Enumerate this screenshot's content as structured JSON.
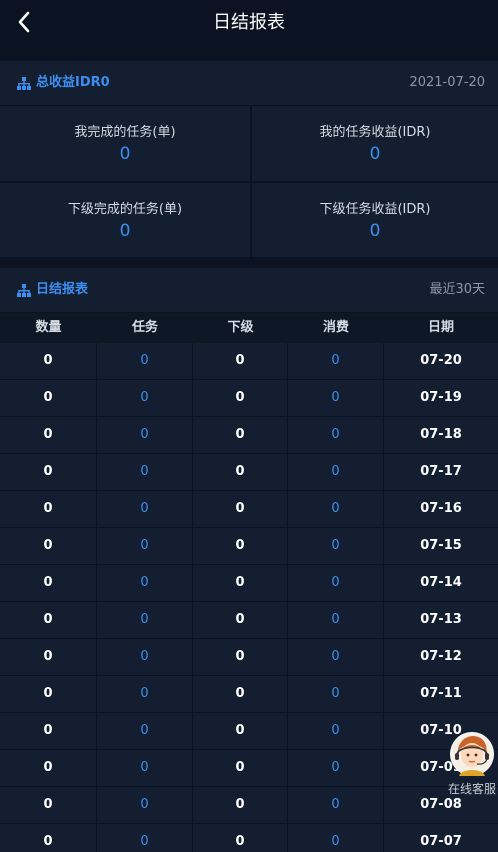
{
  "header": {
    "title": "日结报表"
  },
  "summary": {
    "title": "总收益IDR0",
    "date": "2021-07-20",
    "stats": [
      {
        "label": "我完成的任务(单)",
        "value": "0"
      },
      {
        "label": "我的任务收益(IDR)",
        "value": "0"
      },
      {
        "label": "下级完成的任务(单)",
        "value": "0"
      },
      {
        "label": "下级任务收益(IDR)",
        "value": "0"
      }
    ]
  },
  "daily": {
    "title": "日结报表",
    "range": "最近30天",
    "columns": [
      "数量",
      "任务",
      "下级",
      "消费",
      "日期"
    ],
    "rows": [
      {
        "qty": "0",
        "task": "0",
        "sub": "0",
        "spend": "0",
        "date": "07-20"
      },
      {
        "qty": "0",
        "task": "0",
        "sub": "0",
        "spend": "0",
        "date": "07-19"
      },
      {
        "qty": "0",
        "task": "0",
        "sub": "0",
        "spend": "0",
        "date": "07-18"
      },
      {
        "qty": "0",
        "task": "0",
        "sub": "0",
        "spend": "0",
        "date": "07-17"
      },
      {
        "qty": "0",
        "task": "0",
        "sub": "0",
        "spend": "0",
        "date": "07-16"
      },
      {
        "qty": "0",
        "task": "0",
        "sub": "0",
        "spend": "0",
        "date": "07-15"
      },
      {
        "qty": "0",
        "task": "0",
        "sub": "0",
        "spend": "0",
        "date": "07-14"
      },
      {
        "qty": "0",
        "task": "0",
        "sub": "0",
        "spend": "0",
        "date": "07-13"
      },
      {
        "qty": "0",
        "task": "0",
        "sub": "0",
        "spend": "0",
        "date": "07-12"
      },
      {
        "qty": "0",
        "task": "0",
        "sub": "0",
        "spend": "0",
        "date": "07-11"
      },
      {
        "qty": "0",
        "task": "0",
        "sub": "0",
        "spend": "0",
        "date": "07-10"
      },
      {
        "qty": "0",
        "task": "0",
        "sub": "0",
        "spend": "0",
        "date": "07-09"
      },
      {
        "qty": "0",
        "task": "0",
        "sub": "0",
        "spend": "0",
        "date": "07-08"
      },
      {
        "qty": "0",
        "task": "0",
        "sub": "0",
        "spend": "0",
        "date": "07-07"
      }
    ]
  },
  "customer_service": {
    "label": "在线客服",
    "icon": "customer-service-avatar-icon"
  },
  "colors": {
    "background": "#0b1322",
    "card": "#131e30",
    "accent": "#3d8ef0",
    "muted": "#8e97a7"
  }
}
